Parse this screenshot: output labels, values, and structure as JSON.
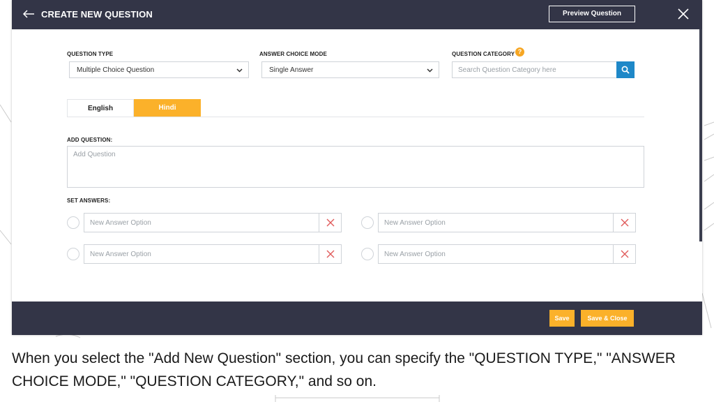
{
  "header": {
    "title": "CREATE NEW QUESTION",
    "preview_label": "Preview Question",
    "back_icon": "arrow-left-icon",
    "close_icon": "close-icon"
  },
  "fields": {
    "question_type": {
      "label": "QUESTION TYPE",
      "value": "Multiple Choice Question"
    },
    "answer_choice_mode": {
      "label": "ANSWER CHOICE MODE",
      "value": "Single Answer"
    },
    "question_category": {
      "label": "QUESTION CATEGORY",
      "placeholder": "Search Question Category here",
      "help_glyph": "?"
    }
  },
  "tabs": [
    {
      "label": "English",
      "active": false
    },
    {
      "label": "Hindi",
      "active": true
    }
  ],
  "question": {
    "label": "ADD QUESTION:",
    "placeholder": "Add Question"
  },
  "answers": {
    "label": "SET ANSWERS:",
    "options": [
      {
        "placeholder": "New Answer Option"
      },
      {
        "placeholder": "New Answer Option"
      },
      {
        "placeholder": "New Answer Option"
      },
      {
        "placeholder": "New Answer Option"
      }
    ]
  },
  "footer": {
    "save_label": "Save",
    "save_close_label": "Save & Close"
  },
  "caption": "When you select the \"Add New Question\" section, you can specify the \"QUESTION TYPE,\" \"ANSWER CHOICE MODE,\" \"QUESTION CATEGORY,\" and so on.",
  "colors": {
    "header_bg": "#333547",
    "accent": "#fbb12a",
    "search_button": "#1e88c8",
    "delete_icon": "#e05a5a"
  }
}
